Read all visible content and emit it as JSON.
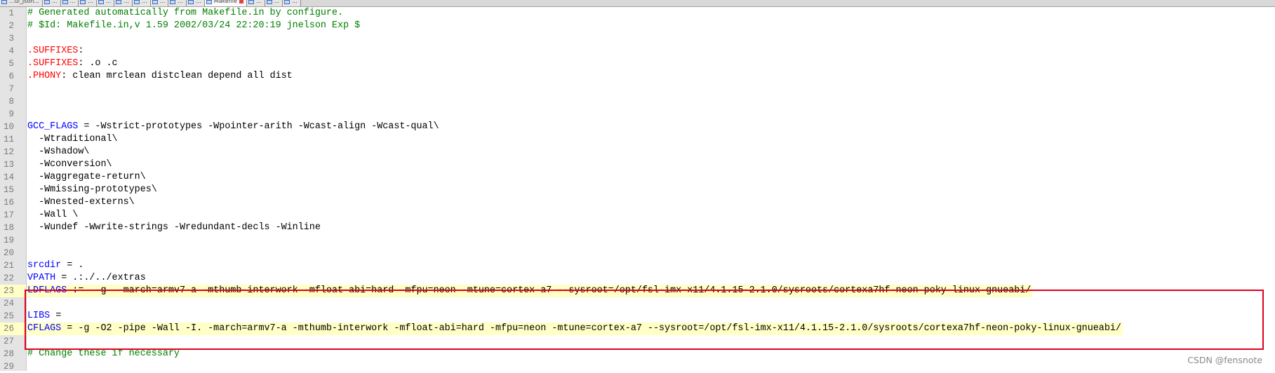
{
  "tabs": [
    {
      "label": "...ui_json...",
      "active": false
    },
    {
      "label": "...",
      "active": false
    },
    {
      "label": "...",
      "active": false
    },
    {
      "label": "...",
      "active": false
    },
    {
      "label": "...",
      "active": false
    },
    {
      "label": "...",
      "active": false
    },
    {
      "label": "...",
      "active": false
    },
    {
      "label": "...",
      "active": false
    },
    {
      "label": "...",
      "active": false
    },
    {
      "label": "...",
      "active": false
    },
    {
      "label": "Makefile",
      "active": true
    },
    {
      "label": "...",
      "active": false
    },
    {
      "label": "...",
      "active": false
    },
    {
      "label": "...",
      "active": false
    }
  ],
  "lines": [
    {
      "n": "1",
      "highlighted": false,
      "tokens": [
        {
          "t": "comment",
          "v": "# Generated automatically from Makefile.in by configure."
        }
      ]
    },
    {
      "n": "2",
      "highlighted": false,
      "tokens": [
        {
          "t": "comment",
          "v": "# $Id: Makefile.in,v 1.59 2002/03/24 22:20:19 jnelson Exp $"
        }
      ]
    },
    {
      "n": "3",
      "highlighted": false,
      "tokens": []
    },
    {
      "n": "4",
      "highlighted": false,
      "tokens": [
        {
          "t": "target",
          "v": ".SUFFIXES"
        },
        {
          "t": "text",
          "v": ":"
        }
      ]
    },
    {
      "n": "5",
      "highlighted": false,
      "tokens": [
        {
          "t": "target",
          "v": ".SUFFIXES"
        },
        {
          "t": "text",
          "v": ": .o .c"
        }
      ]
    },
    {
      "n": "6",
      "highlighted": false,
      "tokens": [
        {
          "t": "target",
          "v": ".PHONY"
        },
        {
          "t": "text",
          "v": ": clean mrclean distclean depend all dist"
        }
      ]
    },
    {
      "n": "7",
      "highlighted": false,
      "tokens": []
    },
    {
      "n": "8",
      "highlighted": false,
      "tokens": []
    },
    {
      "n": "9",
      "highlighted": false,
      "tokens": []
    },
    {
      "n": "10",
      "highlighted": false,
      "tokens": [
        {
          "t": "var",
          "v": "GCC_FLAGS"
        },
        {
          "t": "text",
          "v": " = -Wstrict-prototypes -Wpointer-arith -Wcast-align -Wcast-qual\\"
        }
      ]
    },
    {
      "n": "11",
      "highlighted": false,
      "tokens": [
        {
          "t": "text",
          "v": "  -Wtraditional\\"
        }
      ]
    },
    {
      "n": "12",
      "highlighted": false,
      "tokens": [
        {
          "t": "text",
          "v": "  -Wshadow\\"
        }
      ]
    },
    {
      "n": "13",
      "highlighted": false,
      "tokens": [
        {
          "t": "text",
          "v": "  -Wconversion\\"
        }
      ]
    },
    {
      "n": "14",
      "highlighted": false,
      "tokens": [
        {
          "t": "text",
          "v": "  -Waggregate-return\\"
        }
      ]
    },
    {
      "n": "15",
      "highlighted": false,
      "tokens": [
        {
          "t": "text",
          "v": "  -Wmissing-prototypes\\"
        }
      ]
    },
    {
      "n": "16",
      "highlighted": false,
      "tokens": [
        {
          "t": "text",
          "v": "  -Wnested-externs\\"
        }
      ]
    },
    {
      "n": "17",
      "highlighted": false,
      "tokens": [
        {
          "t": "text",
          "v": "  -Wall \\"
        }
      ]
    },
    {
      "n": "18",
      "highlighted": false,
      "tokens": [
        {
          "t": "text",
          "v": "  -Wundef -Wwrite-strings -Wredundant-decls -Winline"
        }
      ]
    },
    {
      "n": "19",
      "highlighted": false,
      "tokens": []
    },
    {
      "n": "20",
      "highlighted": false,
      "tokens": []
    },
    {
      "n": "21",
      "highlighted": false,
      "tokens": [
        {
          "t": "var",
          "v": "srcdir"
        },
        {
          "t": "text",
          "v": " = ."
        }
      ]
    },
    {
      "n": "22",
      "highlighted": false,
      "tokens": [
        {
          "t": "var",
          "v": "VPATH"
        },
        {
          "t": "text",
          "v": " = .:./../extras"
        }
      ]
    },
    {
      "n": "23",
      "highlighted": true,
      "tokens": [
        {
          "t": "var",
          "v": "LDFLAGS"
        },
        {
          "t": "text",
          "v": " :=  -g  -march=armv7-a -mthumb-interwork -mfloat-abi=hard -mfpu=neon -mtune=cortex-a7 --sysroot=/opt/fsl-imx-x11/4.1.15-2.1.0/sysroots/cortexa7hf-neon-poky-linux-gnueabi/"
        }
      ]
    },
    {
      "n": "24",
      "highlighted": false,
      "tokens": []
    },
    {
      "n": "25",
      "highlighted": false,
      "tokens": [
        {
          "t": "var",
          "v": "LIBS"
        },
        {
          "t": "text",
          "v": " ="
        }
      ]
    },
    {
      "n": "26",
      "highlighted": true,
      "tokens": [
        {
          "t": "var",
          "v": "CFLAGS"
        },
        {
          "t": "text",
          "v": " = -g -O2 -pipe -Wall -I. -march=armv7-a -mthumb-interwork -mfloat-abi=hard -mfpu=neon -mtune=cortex-a7 --sysroot=/opt/fsl-imx-x11/4.1.15-2.1.0/sysroots/cortexa7hf-neon-poky-linux-gnueabi/"
        }
      ]
    },
    {
      "n": "27",
      "highlighted": false,
      "tokens": []
    },
    {
      "n": "28",
      "highlighted": false,
      "tokens": [
        {
          "t": "comment",
          "v": "# Change these if necessary"
        }
      ]
    },
    {
      "n": "29",
      "highlighted": false,
      "tokens": []
    }
  ],
  "watermark": "CSDN @fensnote",
  "colors": {
    "comment": "#008000",
    "target": "#ff0000",
    "variable": "#0000ff",
    "highlight": "#ffffc6",
    "selection_border": "#e0001b"
  }
}
